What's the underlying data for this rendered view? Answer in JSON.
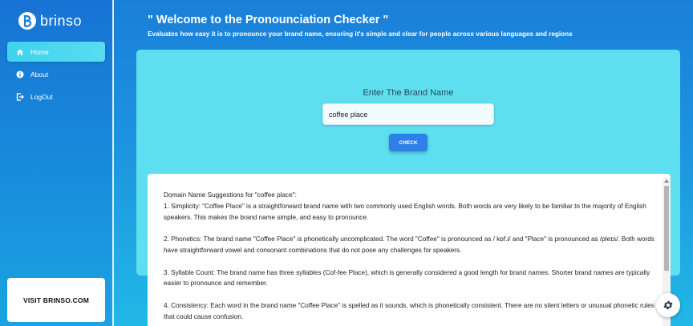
{
  "brand": {
    "name": "brinso"
  },
  "sidebar": {
    "items": [
      {
        "label": "Home",
        "icon": "home-icon",
        "active": true
      },
      {
        "label": "About",
        "icon": "info-icon",
        "active": false
      },
      {
        "label": "LogOut",
        "icon": "logout-icon",
        "active": false
      }
    ],
    "visit_label": "VISIT BRINSO.COM"
  },
  "header": {
    "title": "\" Welcome to the Pronounciation Checker \"",
    "subtitle": "Evaluates how easy it is to pronounce your brand name, ensuring it's simple and clear for people across various languages and regions"
  },
  "form": {
    "prompt": "Enter The Brand Name",
    "input_value": "coffee place",
    "button_label": "CHECK"
  },
  "result": {
    "heading": "Domain Name Suggestions for \"coffee place\":",
    "paragraphs": [
      "1. Simplicity: \"Coffee Place\" is a straightforward brand name with two commonly used English words. Both words are very likely to be familiar to the majority of English speakers. This makes the brand name simple, and easy to pronounce.",
      "2. Phonetics: The brand name \"Coffee Place\" is phonetically uncomplicated. The word \"Coffee\" is pronounced as / kɒf.i/ and \"Place\" is pronounced as /pleɪs/. Both words have straightforward vowel and consonant combinations that do not pose any challenges for speakers.",
      "3. Syllable Count: The brand name has three syllables (Cof-fee Place), which is generally considered a good length for brand names. Shorter brand names are typically easier to pronounce and remember.",
      "4. Consistency: Each word in the brand name \"Coffee Place\" is spelled as it sounds, which is phonetically consistent. There are no silent letters or unusual phonetic rules that could cause confusion."
    ]
  },
  "colors": {
    "sidebar_top": "#1773d4",
    "card": "#5ddff0",
    "button": "#2f7fe8",
    "active_nav": "#4fd8ef"
  },
  "fab": {
    "icon": "gear-icon"
  }
}
